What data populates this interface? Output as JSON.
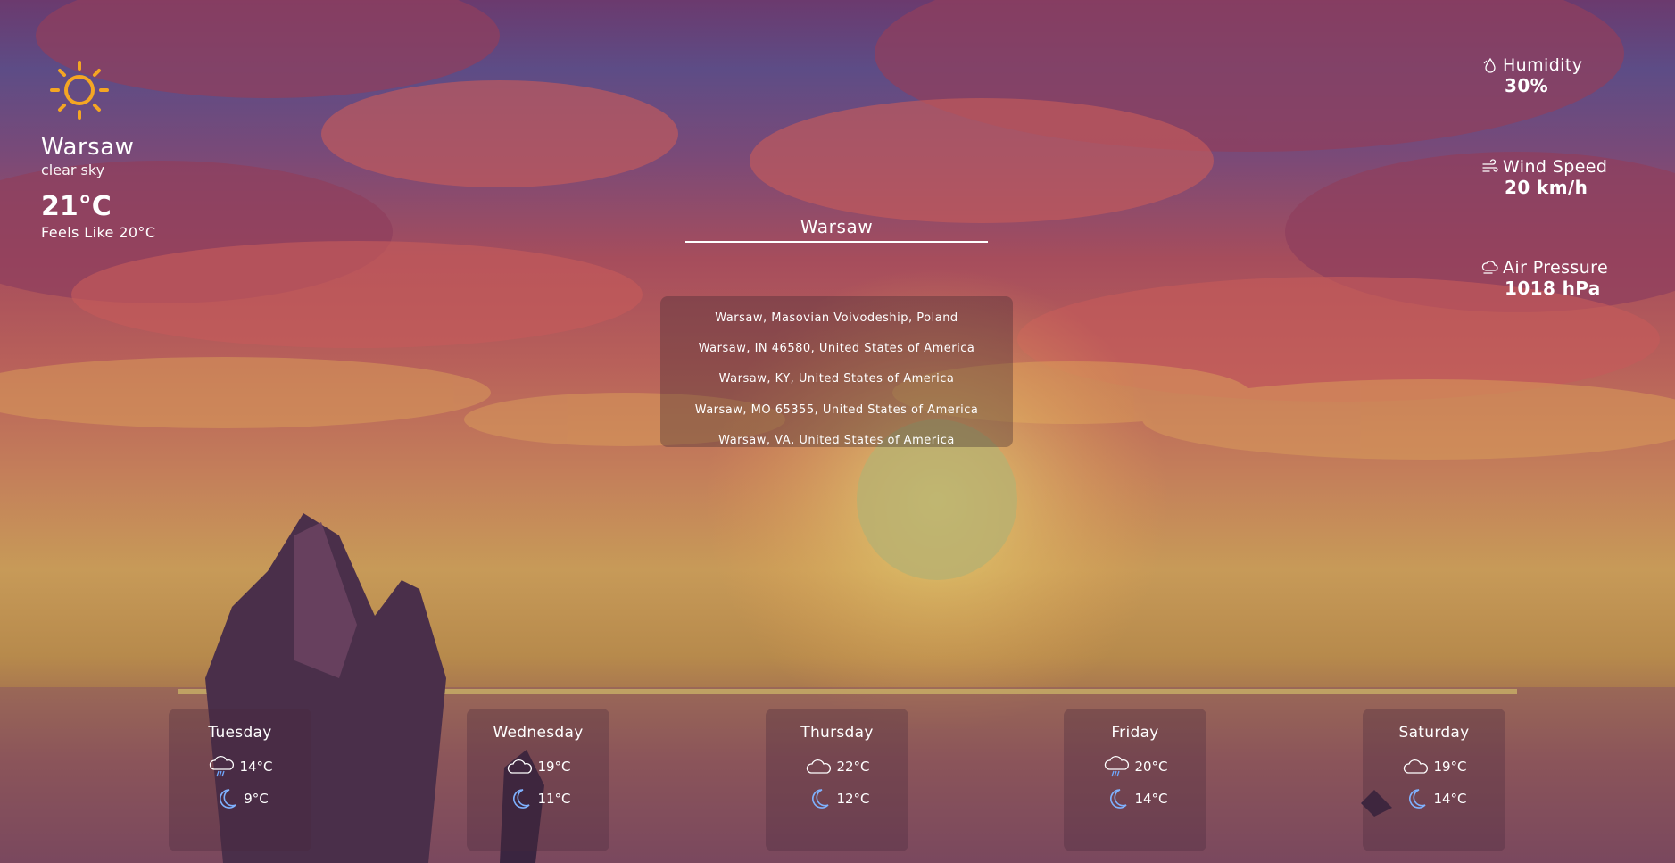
{
  "current": {
    "icon": "sun-icon",
    "city": "Warsaw",
    "description": "clear sky",
    "temperature": "21°C",
    "feels_like": "Feels Like 20°C",
    "accent_color": "#f4a623"
  },
  "search": {
    "value": "Warsaw",
    "suggestions": [
      "Warsaw, Masovian Voivodeship, Poland",
      "Warsaw, IN 46580, United States of America",
      "Warsaw, KY, United States of America",
      "Warsaw, MO 65355, United States of America",
      "Warsaw, VA, United States of America"
    ]
  },
  "stats": {
    "humidity": {
      "label": "Humidity",
      "value": "30%",
      "icon": "humidity-icon"
    },
    "wind": {
      "label": "Wind Speed",
      "value": "20 km/h",
      "icon": "wind-icon"
    },
    "pressure": {
      "label": "Air Pressure",
      "value": "1018 hPa",
      "icon": "pressure-icon"
    }
  },
  "forecast": [
    {
      "day": "Tuesday",
      "day_icon": "rain-cloud-icon",
      "day_temp": "14°C",
      "night_icon": "moon-icon",
      "night_temp": "9°C"
    },
    {
      "day": "Wednesday",
      "day_icon": "cloud-icon",
      "day_temp": "19°C",
      "night_icon": "moon-icon",
      "night_temp": "11°C"
    },
    {
      "day": "Thursday",
      "day_icon": "cloud-icon",
      "day_temp": "22°C",
      "night_icon": "moon-icon",
      "night_temp": "12°C"
    },
    {
      "day": "Friday",
      "day_icon": "rain-cloud-icon",
      "day_temp": "20°C",
      "night_icon": "moon-icon",
      "night_temp": "14°C"
    },
    {
      "day": "Saturday",
      "day_icon": "cloud-icon",
      "day_temp": "19°C",
      "night_icon": "moon-icon",
      "night_temp": "14°C"
    }
  ]
}
